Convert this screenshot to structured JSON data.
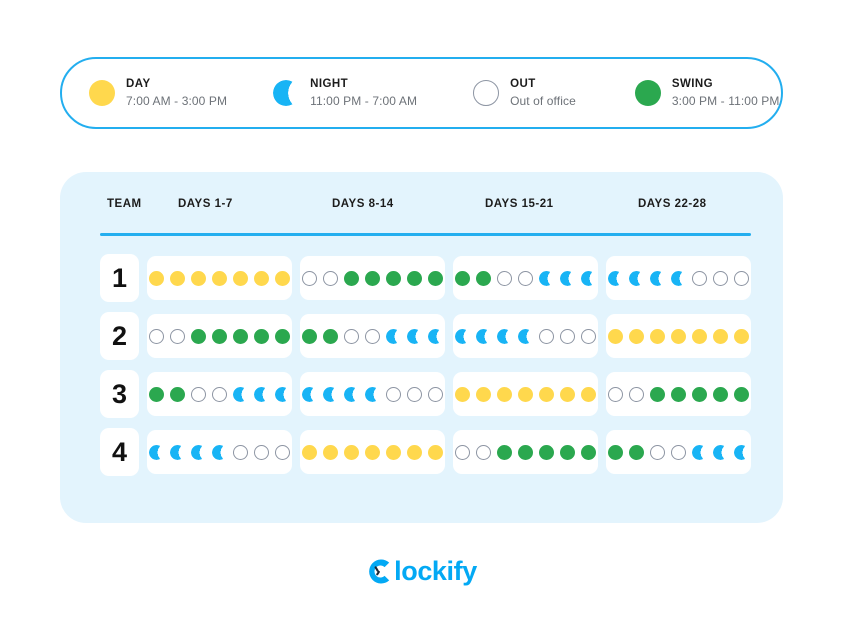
{
  "legend": {
    "items": [
      {
        "key": "day",
        "icon": "filled-circle-yellow",
        "title": "DAY",
        "subtitle": "7:00 AM - 3:00 PM",
        "color": "#FFD84D"
      },
      {
        "key": "night",
        "icon": "crescent-moon-blue",
        "title": "NIGHT",
        "subtitle": "11:00 PM - 7:00 AM",
        "color": "#18B4F5"
      },
      {
        "key": "out",
        "icon": "empty-circle-outline",
        "title": "OUT",
        "subtitle": "Out of office",
        "color": "#8D95A3"
      },
      {
        "key": "swing",
        "icon": "filled-circle-green",
        "title": "SWING",
        "subtitle": "3:00 PM - 11:00 PM",
        "color": "#2BA84F"
      }
    ],
    "border_color": "#23AEEF"
  },
  "schedule": {
    "panel_color": "#E3F4FD",
    "rule_color": "#23AEEF",
    "columns": [
      {
        "key": "team",
        "label": "TEAM"
      },
      {
        "key": "w1",
        "label": "DAYS 1-7"
      },
      {
        "key": "w2",
        "label": "DAYS 8-14"
      },
      {
        "key": "w3",
        "label": "DAYS 15-21"
      },
      {
        "key": "w4",
        "label": "DAYS 22-28"
      }
    ],
    "rows": [
      {
        "team": "1",
        "weeks": [
          [
            "day",
            "day",
            "day",
            "day",
            "day",
            "day",
            "day"
          ],
          [
            "out",
            "out",
            "swing",
            "swing",
            "swing",
            "swing",
            "swing"
          ],
          [
            "swing",
            "swing",
            "out",
            "out",
            "night",
            "night",
            "night"
          ],
          [
            "night",
            "night",
            "night",
            "night",
            "out",
            "out",
            "out"
          ]
        ]
      },
      {
        "team": "2",
        "weeks": [
          [
            "out",
            "out",
            "swing",
            "swing",
            "swing",
            "swing",
            "swing"
          ],
          [
            "swing",
            "swing",
            "out",
            "out",
            "night",
            "night",
            "night"
          ],
          [
            "night",
            "night",
            "night",
            "night",
            "out",
            "out",
            "out"
          ],
          [
            "day",
            "day",
            "day",
            "day",
            "day",
            "day",
            "day"
          ]
        ]
      },
      {
        "team": "3",
        "weeks": [
          [
            "swing",
            "swing",
            "out",
            "out",
            "night",
            "night",
            "night"
          ],
          [
            "night",
            "night",
            "night",
            "night",
            "out",
            "out",
            "out"
          ],
          [
            "day",
            "day",
            "day",
            "day",
            "day",
            "day",
            "day"
          ],
          [
            "out",
            "out",
            "swing",
            "swing",
            "swing",
            "swing",
            "swing"
          ]
        ]
      },
      {
        "team": "4",
        "weeks": [
          [
            "night",
            "night",
            "night",
            "night",
            "out",
            "out",
            "out"
          ],
          [
            "day",
            "day",
            "day",
            "day",
            "day",
            "day",
            "day"
          ],
          [
            "out",
            "out",
            "swing",
            "swing",
            "swing",
            "swing",
            "swing"
          ],
          [
            "swing",
            "swing",
            "out",
            "out",
            "night",
            "night",
            "night"
          ]
        ]
      }
    ]
  },
  "footer": {
    "logo_text": "lockify",
    "logo_mark": "clockify-c-mark",
    "logo_color": "#03A9F4"
  }
}
